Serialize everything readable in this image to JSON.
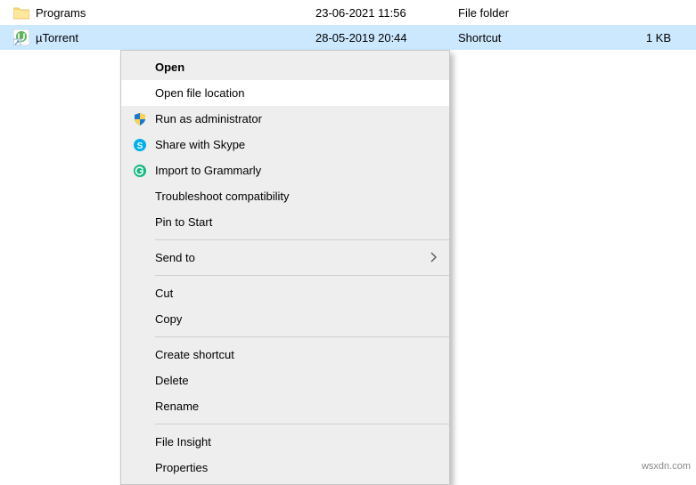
{
  "rows": [
    {
      "name": "Programs",
      "date": "23-06-2021 11:56",
      "type": "File folder",
      "size": ""
    },
    {
      "name": "µTorrent",
      "date": "28-05-2019 20:44",
      "type": "Shortcut",
      "size": "1 KB"
    }
  ],
  "menu": {
    "open": "Open",
    "open_location": "Open file location",
    "run_admin": "Run as administrator",
    "share_skype": "Share with Skype",
    "import_grammarly": "Import to Grammarly",
    "troubleshoot": "Troubleshoot compatibility",
    "pin_start": "Pin to Start",
    "send_to": "Send to",
    "cut": "Cut",
    "copy": "Copy",
    "create_shortcut": "Create shortcut",
    "delete": "Delete",
    "rename": "Rename",
    "file_insight": "File Insight",
    "properties": "Properties"
  },
  "watermark": "wsxdn.com"
}
